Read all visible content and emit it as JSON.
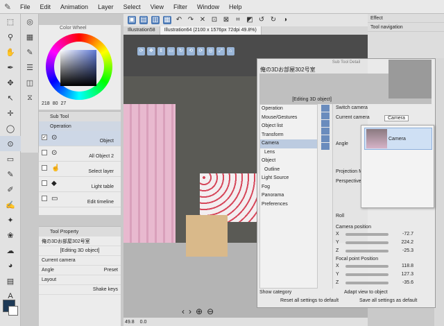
{
  "menubar": {
    "items": [
      "File",
      "Edit",
      "Animation",
      "Layer",
      "Select",
      "View",
      "Filter",
      "Window",
      "Help"
    ]
  },
  "tabs": [
    "Illustration58",
    "Illustration64 (2100 x 1576px 72dpi 49.8%)"
  ],
  "color_wheel": {
    "title": "Color Wheel",
    "h": "218",
    "s": "80",
    "v": "27"
  },
  "sub_tool": {
    "title": "Sub Tool",
    "tab": "Operation",
    "items": [
      "Object",
      "All Object 2",
      "Select layer",
      "Light table",
      "Edit timeline"
    ]
  },
  "tool_property": {
    "title": "Tool Property",
    "name": "俺の3Dお部屋302号室",
    "editing": "[Editing 3D object]",
    "rows": [
      {
        "label": "Current camera"
      },
      {
        "label": "Angle",
        "value": "Preset"
      },
      {
        "label": "Layout"
      },
      {
        "label": "Shake keys"
      }
    ]
  },
  "dialog": {
    "title": "Sub Tool Detail",
    "name": "俺の3Dお部屋302号室",
    "editing": "[Editing 3D object]",
    "categories": [
      "Operation",
      "Mouse/Gestures",
      "Object list",
      "Transform",
      "Camera",
      "Lens",
      "Object",
      "Outline",
      "Light Source",
      "Fog",
      "Panorama",
      "Preferences"
    ],
    "selected_category": "Camera",
    "switch_camera": "Switch camera",
    "current_camera_label": "Current camera",
    "current_camera_value": "Camera",
    "angle": "Angle",
    "projection": "Projection M",
    "perspective": "Perspective",
    "roll": "Roll",
    "camera_position": "Camera position",
    "focal_point": "Focal point Position",
    "cam_pos": [
      {
        "axis": "X",
        "value": "-72.7"
      },
      {
        "axis": "Y",
        "value": "224.2"
      },
      {
        "axis": "Z",
        "value": "-25.3"
      }
    ],
    "focal_pos": [
      {
        "axis": "X",
        "value": "118.8"
      },
      {
        "axis": "Y",
        "value": "127.3"
      },
      {
        "axis": "Z",
        "value": "-35.6"
      }
    ],
    "adapt_view": "Adapt view to object",
    "show_category": "Show category",
    "reset_all": "Reset all settings to default",
    "save_all": "Save all settings as default"
  },
  "camera_popup": {
    "item": "Camera"
  },
  "right_panel": {
    "effect": "Effect",
    "tool_navigation": "Tool navigation"
  },
  "status": {
    "zoom": "49.8",
    "rot": "0.0"
  }
}
